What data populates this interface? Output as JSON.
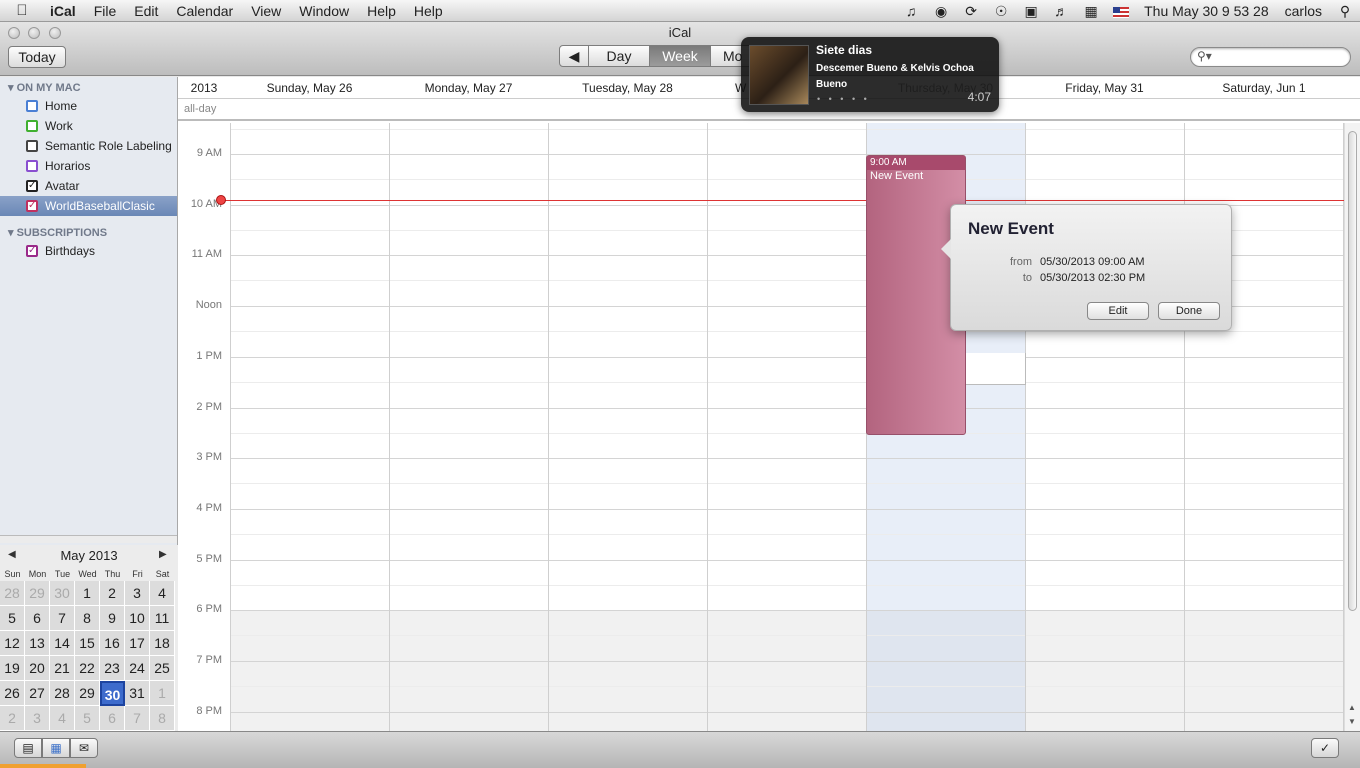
{
  "menubar": {
    "app_name": "iCal",
    "menus": [
      "File",
      "Edit",
      "Calendar",
      "View",
      "Window",
      "Help",
      "Help"
    ],
    "status_icons": [
      "music-note-icon",
      "color-wheel-icon",
      "sync-icon",
      "accessibility-icon",
      "lock-icon",
      "volume-icon",
      "input-icon"
    ],
    "clock": "Thu May 30  9 53 28",
    "user": "carlos"
  },
  "window": {
    "title": "iCal",
    "today_label": "Today",
    "view_tabs": [
      "Day",
      "Week",
      "Mo"
    ],
    "selected_tab": "Week"
  },
  "sidebar": {
    "section_mac": "ON MY MAC",
    "calendars": [
      {
        "label": "Home",
        "color": "#4a7fd4",
        "checked": false
      },
      {
        "label": "Work",
        "color": "#40b030",
        "checked": false
      },
      {
        "label": "Semantic Role Labeling",
        "color": "#444444",
        "checked": false
      },
      {
        "label": "Horarios",
        "color": "#8a4fd0",
        "checked": false
      },
      {
        "label": "Avatar",
        "color": "#222222",
        "checked": true
      },
      {
        "label": "WorldBaseballClasic",
        "color": "#c03060",
        "checked": true,
        "selected": true
      }
    ],
    "section_subs": "SUBSCRIPTIONS",
    "subscriptions": [
      {
        "label": "Birthdays",
        "color": "#9a2a8a",
        "checked": true
      }
    ]
  },
  "minical": {
    "title": "May 2013",
    "weekdays": [
      "Sun",
      "Mon",
      "Tue",
      "Wed",
      "Thu",
      "Fri",
      "Sat"
    ],
    "weeks": [
      [
        "28",
        "29",
        "30",
        "1",
        "2",
        "3",
        "4"
      ],
      [
        "5",
        "6",
        "7",
        "8",
        "9",
        "10",
        "11"
      ],
      [
        "12",
        "13",
        "14",
        "15",
        "16",
        "17",
        "18"
      ],
      [
        "19",
        "20",
        "21",
        "22",
        "23",
        "24",
        "25"
      ],
      [
        "26",
        "27",
        "28",
        "29",
        "30",
        "31",
        "1"
      ],
      [
        "2",
        "3",
        "4",
        "5",
        "6",
        "7",
        "8"
      ]
    ],
    "today": "30"
  },
  "week": {
    "year": "2013",
    "days": [
      "Sunday, May 26",
      "Monday, May 27",
      "Tuesday, May 28",
      "W",
      "Thursday, May 30",
      "Friday, May 31",
      "Saturday, Jun 1"
    ],
    "allday_label": "all-day",
    "time_labels": [
      "9 AM",
      "10 AM",
      "11 AM",
      "Noon",
      "1 PM",
      "2 PM",
      "3 PM",
      "4 PM",
      "5 PM",
      "6 PM",
      "7 PM",
      "8 PM"
    ]
  },
  "event": {
    "time": "9:00 AM",
    "title": "New Event"
  },
  "popover": {
    "title": "New Event",
    "from_label": "from",
    "from_value": "05/30/2013 09:00 AM",
    "to_label": "to",
    "to_value": "05/30/2013 02:30 PM",
    "edit_label": "Edit",
    "done_label": "Done"
  },
  "growl": {
    "track": "Siete dias",
    "artist": "Descemer Bueno & Kelvis Ochoa Bueno",
    "rating": "• • • • •",
    "duration": "4:07"
  }
}
